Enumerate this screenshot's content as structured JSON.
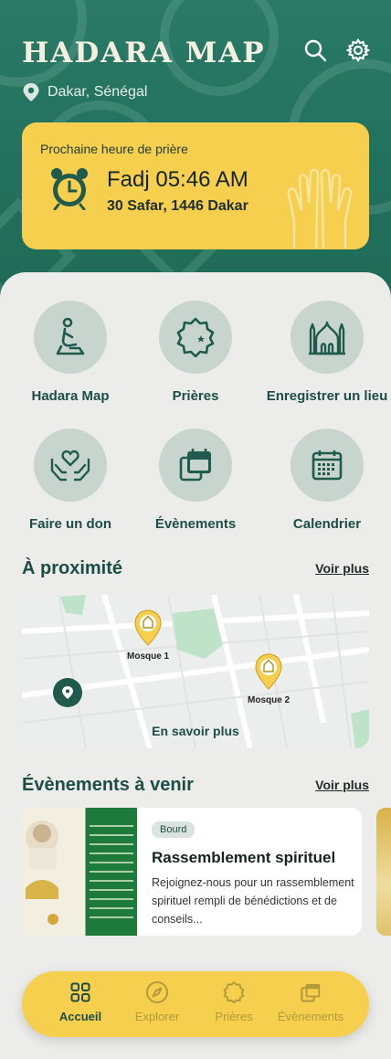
{
  "header": {
    "app_title": "HADARA MAP",
    "location": "Dakar, Sénégal",
    "icons": [
      "search-icon",
      "gear-icon",
      "location-pin-icon"
    ]
  },
  "prayer_card": {
    "heading": "Prochaine heure de prière",
    "next_prayer": "Fadj 05:46 AM",
    "date": "30 Safar, 1446 Dakar",
    "icons": [
      "alarm-clock-icon",
      "praying-hands-icon"
    ]
  },
  "quick_actions": [
    {
      "label": "Hadara Map",
      "icon": "prayer-person-icon"
    },
    {
      "label": "Prières",
      "icon": "crescent-star-badge-icon"
    },
    {
      "label": "Enregistrer un lieu",
      "icon": "mosque-icon"
    },
    {
      "label": "Faire un don",
      "icon": "heart-hands-icon"
    },
    {
      "label": "Évènements",
      "icon": "calendar-stack-icon"
    },
    {
      "label": "Calendrier",
      "icon": "calendar-icon"
    }
  ],
  "nearby": {
    "title": "À proximité",
    "see_more": "Voir plus",
    "markers": [
      {
        "label": "Mosque 1"
      },
      {
        "label": "Mosque 2"
      }
    ],
    "cta": "En savoir plus"
  },
  "events": {
    "title": "Évènements à venir",
    "see_more": "Voir plus",
    "items": [
      {
        "tag": "Bourd",
        "title": "Rassemblement spirituel",
        "description": "Rejoignez-nous pour un rassemblement spirituel rempli de bénédictions et de conseils..."
      }
    ]
  },
  "bottom_nav": {
    "items": [
      {
        "label": "Accueil",
        "icon": "grid-icon",
        "active": true
      },
      {
        "label": "Explorer",
        "icon": "compass-icon",
        "active": false
      },
      {
        "label": "Prières",
        "icon": "crescent-star-badge-icon",
        "active": false
      },
      {
        "label": "Évènements",
        "icon": "calendar-stack-icon",
        "active": false
      }
    ]
  },
  "colors": {
    "primary": "#1d4d45",
    "hero": "#21705c",
    "accent_yellow": "#f6cf4e",
    "icon_circle": "#c8d5cf",
    "background": "#ececea"
  }
}
